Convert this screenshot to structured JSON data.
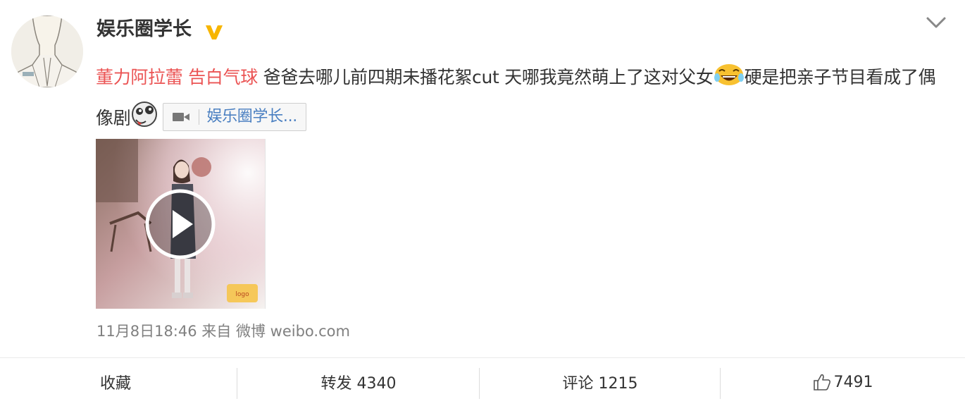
{
  "author": {
    "name": "娱乐圈学长",
    "verified_color": "#f7b500"
  },
  "post": {
    "topic_1": "董力阿拉蕾",
    "topic_2": "告白气球",
    "text_1": "爸爸去哪儿前四期未播花絮cut 天哪我竟然萌上了这对父女",
    "text_2": "硬是把亲子节目看成了偶像剧",
    "video_link_label": "娱乐圈学长...",
    "emoji_1": "laugh-cry-emoji",
    "emoji_2": "drool-emoji"
  },
  "meta": {
    "time": "11月8日18:46",
    "from_label": "来自",
    "source": "微博 weibo.com"
  },
  "actions": {
    "favorite": "收藏",
    "repost": "转发 4340",
    "comment": "评论 1215",
    "like": "7491"
  },
  "colors": {
    "topic": "#eb5454",
    "link": "#4a7fc1",
    "meta": "#808080"
  }
}
